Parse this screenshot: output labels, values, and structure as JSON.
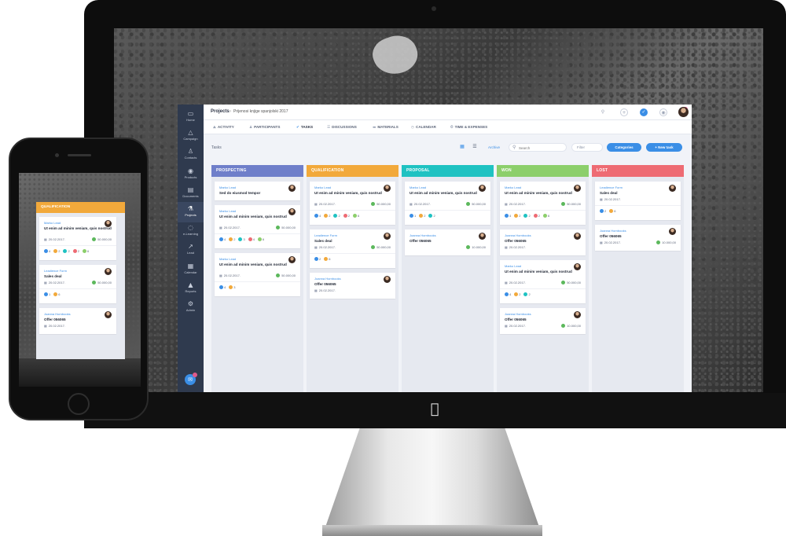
{
  "app": {
    "breadcrumb": {
      "section": "Projects",
      "separator": "›",
      "project": "Prijenosi knjige spanjolski 2017"
    },
    "notifications_count": "2",
    "sidebar": [
      {
        "label": "Home",
        "icon": "monitor-icon"
      },
      {
        "label": "Campaign",
        "icon": "triangle-icon"
      },
      {
        "label": "Contacts",
        "icon": "person-icon"
      },
      {
        "label": "Products",
        "icon": "products-icon"
      },
      {
        "label": "Documents",
        "icon": "documents-icon"
      },
      {
        "label": "Projects",
        "icon": "projects-icon"
      },
      {
        "label": "e-Learning",
        "icon": "bulb-icon"
      },
      {
        "label": "Lead",
        "icon": "trend-icon"
      },
      {
        "label": "Calendar",
        "icon": "calendar-icon"
      },
      {
        "label": "Reports",
        "icon": "mountain-icon"
      },
      {
        "label": "Admin",
        "icon": "gear-icon"
      }
    ],
    "tabs": [
      {
        "label": "ACTIVITY",
        "icon": "activity-icon"
      },
      {
        "label": "PARTICIPANTS",
        "icon": "participants-icon"
      },
      {
        "label": "TASKS",
        "icon": "tasks-icon"
      },
      {
        "label": "DISCUSSIONS",
        "icon": "discussions-icon"
      },
      {
        "label": "MATERIALS",
        "icon": "materials-icon"
      },
      {
        "label": "CALENDAR",
        "icon": "calendar-icon"
      },
      {
        "label": "TIME & EXPENSES",
        "icon": "time-icon"
      }
    ],
    "toolbar": {
      "title": "Tasks",
      "archive": "Archive",
      "search_placeholder": "Search",
      "filter": "Filter",
      "categories": "Categories",
      "new_task": "+ New task"
    },
    "columns": [
      {
        "title": "PROSPECTING",
        "color": "#6f7fca",
        "cards": [
          {
            "owner": "Marko Lead",
            "title": "Sed do eiusmod tempor",
            "date": "",
            "amount": "",
            "stats": []
          },
          {
            "owner": "Marko Lead",
            "title": "Ut enim ad minim veniam, quis nostrud",
            "date": "20.02.2017.",
            "amount": "50.000,00",
            "stats": [
              "4",
              "2",
              "3",
              "4",
              "6"
            ]
          },
          {
            "owner": "Marko Lead",
            "title": "Ut enim ad minim veniam, quis nostrud",
            "date": "20.02.2017.",
            "amount": "50.000,00",
            "stats": [
              "4",
              "3"
            ]
          }
        ]
      },
      {
        "title": "QUALIFICATION",
        "color": "#f2a93b",
        "cards": [
          {
            "owner": "Marko Lead",
            "title": "Ut enim ad minim veniam, quis nostrud",
            "date": "20.02.2017.",
            "amount": "50.000,00",
            "stats": [
              "4",
              "2",
              "2",
              "2",
              "6"
            ]
          },
          {
            "owner": "Leadience Form",
            "title": "Sales deal",
            "date": "20.02.2017.",
            "amount": "50.000,00",
            "stats": [
              "2",
              "6"
            ]
          },
          {
            "owner": "Joanna Hornbooks",
            "title": "Offer 056065",
            "date": "20.02.2017.",
            "amount": "",
            "stats": []
          }
        ]
      },
      {
        "title": "PROPOSAL",
        "color": "#1fc2c2",
        "cards": [
          {
            "owner": "Marko Lead",
            "title": "Ut enim ad minim veniam, quis nostrud",
            "date": "20.02.2017.",
            "amount": "50.000,00",
            "stats": [
              "1",
              "2",
              "2"
            ]
          },
          {
            "owner": "Joanna Hornbooks",
            "title": "Offer 056065",
            "date": "",
            "amount": "10.000,00",
            "stats": []
          }
        ]
      },
      {
        "title": "WON",
        "color": "#8ccf6b",
        "cards": [
          {
            "owner": "Marko Lead",
            "title": "Ut enim ad minim veniam, quis nostrud",
            "date": "20.02.2017.",
            "amount": "50.000,00",
            "stats": [
              "4",
              "2",
              "2",
              "2",
              "6"
            ]
          },
          {
            "owner": "Joanna Hornbooks",
            "title": "Offer 056065",
            "date": "20.02.2017.",
            "amount": "",
            "stats": []
          },
          {
            "owner": "Marko Lead",
            "title": "Ut enim ad minim veniam, quis nostrud",
            "date": "20.02.2017.",
            "amount": "50.000,00",
            "stats": [
              "4",
              "2",
              "2"
            ]
          },
          {
            "owner": "Joanna Hornbooks",
            "title": "Offer 056065",
            "date": "20.02.2017.",
            "amount": "10.000,00",
            "stats": []
          }
        ]
      },
      {
        "title": "LOST",
        "color": "#ee6b73",
        "cards": [
          {
            "owner": "Leadience Form",
            "title": "Sales deal",
            "date": "20.02.2017.",
            "amount": "",
            "stats": [
              "2",
              "6"
            ]
          },
          {
            "owner": "Joanna Hornbooks",
            "title": "Offer 056065",
            "date": "20.02.2017.",
            "amount": "10.000,00",
            "stats": []
          }
        ]
      }
    ]
  },
  "phone": {
    "column_title": "QUALIFICATION",
    "cards": [
      {
        "owner": "Marko Lead",
        "title": "Ut enim ad minim veniam, quis nostrud",
        "date": "20.02.2017.",
        "amount": "50.000,00",
        "stats": [
          "4",
          "2",
          "2",
          "2",
          "6"
        ]
      },
      {
        "owner": "Leadience Form",
        "title": "Sales deal",
        "date": "20.02.2017.",
        "amount": "50.000,00",
        "stats": [
          "1",
          "6"
        ]
      },
      {
        "owner": "Joanna Hornbooks",
        "title": "Offer 056065",
        "date": "20.02.2017.",
        "amount": "",
        "stats": []
      }
    ]
  },
  "stat_colors": [
    "#3a8ee6",
    "#f2a93b",
    "#1fc2c2",
    "#ee6b73",
    "#8ccf6b"
  ]
}
